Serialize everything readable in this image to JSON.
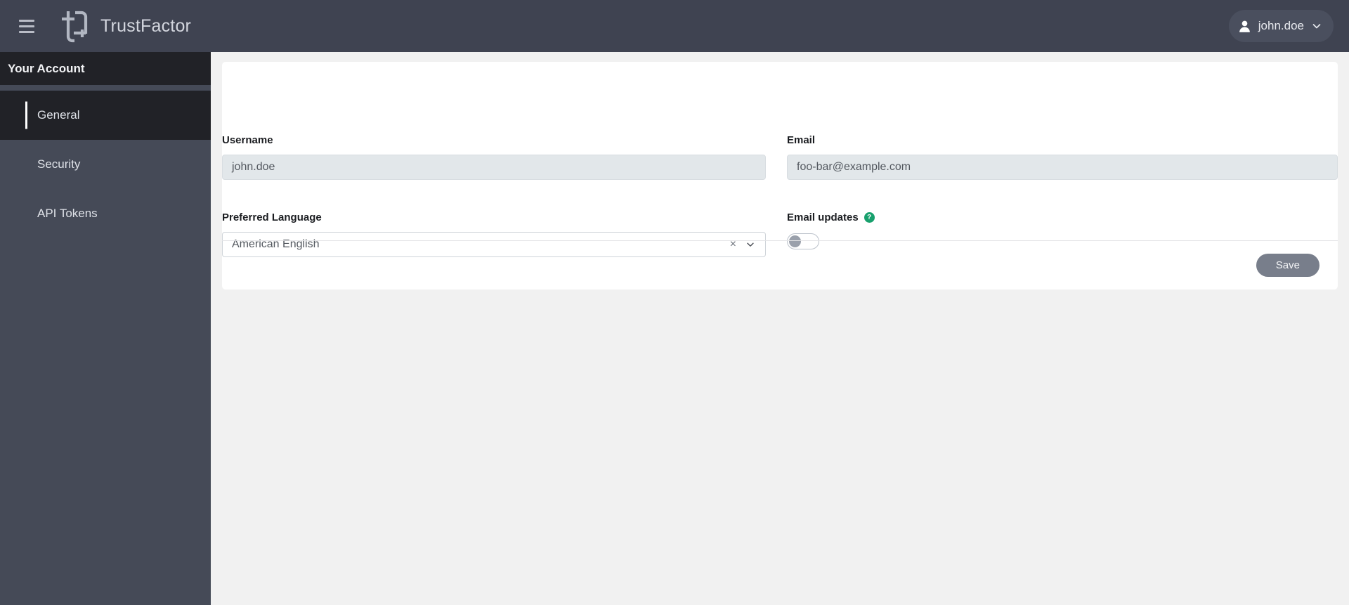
{
  "header": {
    "menu_icon": "hamburger-icon",
    "brand_name": "TrustFactor",
    "logo_icon": "trustfactor-logo",
    "user": {
      "name": "john.doe",
      "avatar_icon": "person-icon",
      "chevron_icon": "chevron-down-icon"
    }
  },
  "sidebar": {
    "title": "Your Account",
    "items": [
      {
        "label": "General",
        "active": true
      },
      {
        "label": "Security",
        "active": false
      },
      {
        "label": "API Tokens",
        "active": false
      }
    ]
  },
  "main": {
    "fields": {
      "username": {
        "label": "Username",
        "value": "john.doe",
        "placeholder": "Username"
      },
      "email": {
        "label": "Email",
        "value": "foo-bar@example.com",
        "placeholder": "Email"
      },
      "preferred_language": {
        "label": "Preferred Language",
        "value": "American English",
        "clear_icon": "close-icon",
        "chevron_icon": "chevron-down-icon"
      },
      "email_updates": {
        "label": "Email updates",
        "help_icon": "question-mark-icon",
        "help_glyph": "?",
        "toggle_state": "off"
      }
    },
    "save_label": "Save"
  },
  "colors": {
    "header_bg": "#3f4351",
    "sidebar_bg": "#454a57",
    "sidebar_dark": "#212227",
    "page_bg": "#f1f1f1",
    "help_green": "#18a06d",
    "save_gray": "#787e8b"
  }
}
